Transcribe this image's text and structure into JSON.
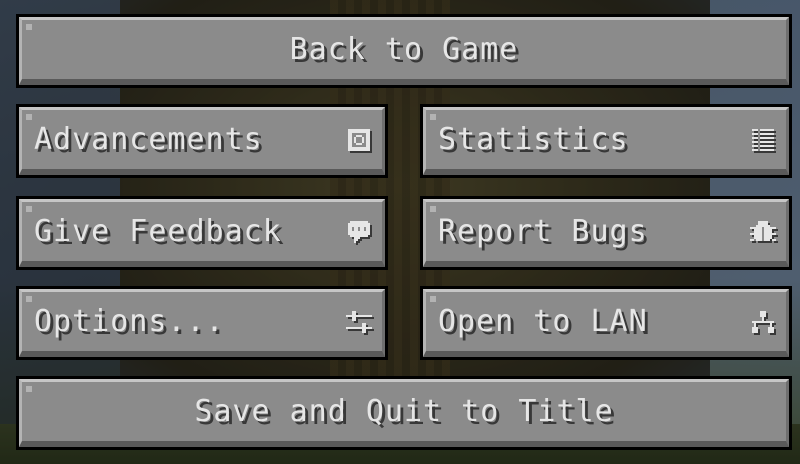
{
  "pause_menu": {
    "back_to_game": "Back to Game",
    "advancements": "Advancements",
    "statistics": "Statistics",
    "give_feedback": "Give Feedback",
    "report_bugs": "Report Bugs",
    "options": "Options...",
    "open_to_lan": "Open to LAN",
    "save_and_quit": "Save and Quit to Title"
  },
  "icons": {
    "advancements": "advancements-icon",
    "statistics": "statistics-icon",
    "give_feedback": "speech-bubble-icon",
    "report_bugs": "bug-icon",
    "options": "sliders-icon",
    "open_to_lan": "network-icon"
  },
  "colors": {
    "button_face": "#8b8b8b",
    "button_text": "#e6e6e6",
    "text_shadow": "#383838",
    "outline": "#000000"
  }
}
